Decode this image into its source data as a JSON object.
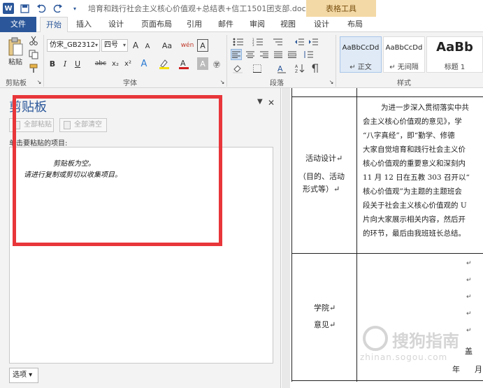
{
  "titlebar": {
    "app_icon_text": "W",
    "save_icon": "save-icon",
    "undo_icon": "undo-icon",
    "redo_icon": "redo-icon",
    "doc_title": "培育和践行社会主义核心价值观+总结表+信工1501团支部.doc...",
    "context_tab": "表格工具"
  },
  "tabs": [
    "文件",
    "开始",
    "插入",
    "设计",
    "页面布局",
    "引用",
    "邮件",
    "审阅",
    "视图",
    "设计",
    "布局"
  ],
  "ribbon": {
    "clipboard": {
      "paste_label": "粘贴",
      "group_label": "剪贴板"
    },
    "font": {
      "font_name": "仿宋_GB2312",
      "font_size": "四号",
      "grow": "A",
      "shrink": "A",
      "case": "Aa",
      "phonetic": "wén",
      "border_char": "A",
      "bold": "B",
      "italic": "I",
      "underline": "U",
      "strike": "abc",
      "subscript": "x₂",
      "superscript": "x²",
      "group_label": "字体"
    },
    "paragraph": {
      "group_label": "段落"
    },
    "styles": {
      "items": [
        {
          "sample": "AaBbCcDd",
          "name": "↵ 正文"
        },
        {
          "sample": "AaBbCcDd",
          "name": "↵ 无间隔"
        },
        {
          "sample": "AaBb",
          "name": "标题 1"
        }
      ],
      "group_label": "样式"
    }
  },
  "clipboard_pane": {
    "title": "剪贴板",
    "paste_all": "全部粘贴",
    "clear_all": "全部清空",
    "hint": "单击要粘贴的项目:",
    "empty_line1": "剪贴板为空。",
    "empty_line2": "请进行复制或剪切以收集项目。",
    "options": "选项 ▾"
  },
  "document": {
    "row1_label": [
      "活动设计↵",
      "（目的、活动",
      "形式等）↵"
    ],
    "row1_body": [
      "为进一步深入贯彻落实中共",
      "会主义核心价值观的意见》，学",
      "“八字真经”，即“勤学、修德",
      "大家自觉培育和践行社会主义价",
      "核心价值观的重要意义和深刻内",
      "11 月 12 日在五教 303 召开以“",
      "核心价值观”为主题的主题班会",
      "段关于社会主义核心价值观的 U",
      "片向大家展示相关内容，然后开",
      "的环节，最后由我班班长总结。"
    ],
    "row2_label": [
      "学院↵",
      "意见↵"
    ],
    "sign_char": "盖",
    "date_chars": [
      "年",
      "月"
    ],
    "watermark_main": "搜狗指南",
    "watermark_sub": "zhinan.sogou.com"
  }
}
